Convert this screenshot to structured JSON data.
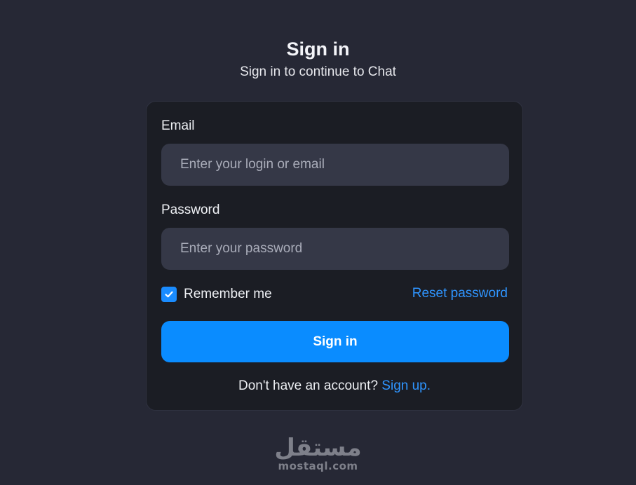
{
  "header": {
    "title": "Sign in",
    "subtitle": "Sign in to continue to Chat"
  },
  "form": {
    "email_label": "Email",
    "email_placeholder": "Enter your login or email",
    "email_value": "",
    "password_label": "Password",
    "password_placeholder": "Enter your password",
    "password_value": "",
    "remember_label": "Remember me",
    "remember_checked": true,
    "reset_label": "Reset password",
    "submit_label": "Sign in",
    "no_account_text": "Don't have an account?",
    "signup_label": "Sign up."
  },
  "watermark": {
    "arabic": "مستقل",
    "latin": "mostaql.com"
  },
  "colors": {
    "background": "#262835",
    "card": "#1b1d24",
    "input": "#353847",
    "accent": "#0a8cff",
    "link": "#2f95ff"
  },
  "icons": {
    "checkbox": "check-icon"
  }
}
